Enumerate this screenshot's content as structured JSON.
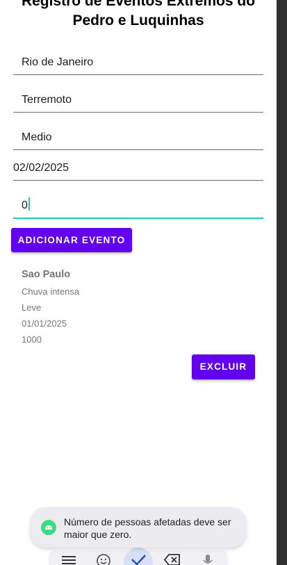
{
  "title": "Registro de Eventos Extremos do Pedro e Luquinhas",
  "form": {
    "location": "Rio de Janeiro",
    "event_type": "Terremoto",
    "severity": "Medio",
    "date": "02/02/2025",
    "affected": "0",
    "add_button": "ADICIONAR EVENTO"
  },
  "events": [
    {
      "city": "Sao Paulo",
      "type": "Chuva intensa",
      "severity": "Leve",
      "date": "01/01/2025",
      "affected": "1000",
      "delete_button": "EXCLUIR"
    }
  ],
  "toast": {
    "message": "Número de pessoas afetadas deve ser maior que zero.",
    "icon": "android-icon",
    "icon_color": "#3ddc84"
  },
  "keyboard": {
    "keys": [
      "menu-icon",
      "emoji-icon",
      "check-icon",
      "backspace-icon",
      "mic-icon"
    ]
  },
  "colors": {
    "primary": "#6200ee",
    "focus": "#26c6c6"
  }
}
